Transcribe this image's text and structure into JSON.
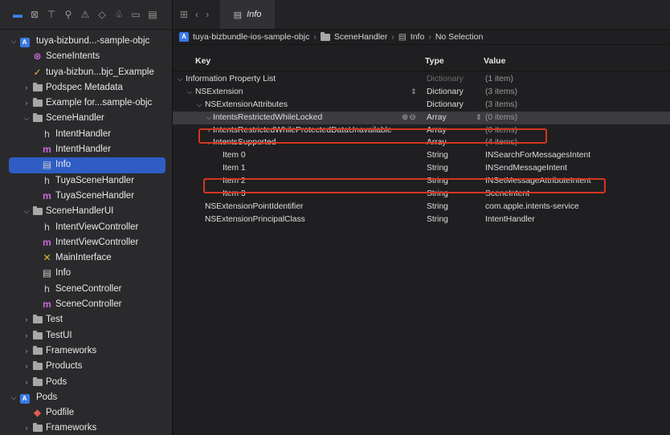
{
  "toolbar": {
    "icons": [
      "folder-icon",
      "source-control-icon",
      "hierarchy-icon",
      "search-icon",
      "warning-icon",
      "breakpoint-icon",
      "debug-icon",
      "tag-icon",
      "report-icon"
    ]
  },
  "sidebar": {
    "items": [
      {
        "label": "tuya-bizbund...-sample-objc",
        "icon": "project-icon",
        "level": 0,
        "disclosure": "open"
      },
      {
        "label": "SceneIntents",
        "icon": "intents-icon",
        "level": 1,
        "disclosure": "none"
      },
      {
        "label": "tuya-bizbun...bjc_Example",
        "icon": "entitlements-icon",
        "level": 1,
        "disclosure": "none"
      },
      {
        "label": "Podspec Metadata",
        "icon": "folder-icon",
        "level": 1,
        "disclosure": "closed"
      },
      {
        "label": "Example for...sample-objc",
        "icon": "folder-icon",
        "level": 1,
        "disclosure": "closed"
      },
      {
        "label": "SceneHandler",
        "icon": "folder-icon",
        "level": 1,
        "disclosure": "open"
      },
      {
        "label": "IntentHandler",
        "icon": "header-icon",
        "level": 2,
        "disclosure": "none"
      },
      {
        "label": "IntentHandler",
        "icon": "objc-icon",
        "level": 2,
        "disclosure": "none"
      },
      {
        "label": "Info",
        "icon": "table-icon",
        "level": 2,
        "disclosure": "none",
        "selected": true
      },
      {
        "label": "TuyaSceneHandler",
        "icon": "header-icon",
        "level": 2,
        "disclosure": "none"
      },
      {
        "label": "TuyaSceneHandler",
        "icon": "objc-icon",
        "level": 2,
        "disclosure": "none"
      },
      {
        "label": "SceneHandlerUI",
        "icon": "folder-icon",
        "level": 1,
        "disclosure": "open"
      },
      {
        "label": "IntentViewController",
        "icon": "header-icon",
        "level": 2,
        "disclosure": "none"
      },
      {
        "label": "IntentViewController",
        "icon": "objc-icon",
        "level": 2,
        "disclosure": "none"
      },
      {
        "label": "MainInterface",
        "icon": "storyboard-icon",
        "level": 2,
        "disclosure": "none"
      },
      {
        "label": "Info",
        "icon": "table-icon",
        "level": 2,
        "disclosure": "none"
      },
      {
        "label": "SceneController",
        "icon": "header-icon",
        "level": 2,
        "disclosure": "none"
      },
      {
        "label": "SceneController",
        "icon": "objc-icon",
        "level": 2,
        "disclosure": "none"
      },
      {
        "label": "Test",
        "icon": "folder-icon",
        "level": 1,
        "disclosure": "closed"
      },
      {
        "label": "TestUI",
        "icon": "folder-icon",
        "level": 1,
        "disclosure": "closed"
      },
      {
        "label": "Frameworks",
        "icon": "folder-icon",
        "level": 1,
        "disclosure": "closed"
      },
      {
        "label": "Products",
        "icon": "folder-icon",
        "level": 1,
        "disclosure": "closed"
      },
      {
        "label": "Pods",
        "icon": "folder-icon",
        "level": 1,
        "disclosure": "closed"
      },
      {
        "label": "Pods",
        "icon": "project-icon",
        "level": 0,
        "disclosure": "open"
      },
      {
        "label": "Podfile",
        "icon": "ruby-icon",
        "level": 1,
        "disclosure": "none"
      },
      {
        "label": "Frameworks",
        "icon": "folder-icon",
        "level": 1,
        "disclosure": "closed"
      }
    ]
  },
  "tab": {
    "label": "Info"
  },
  "jumpbar": {
    "items": [
      "tuya-bizbundle-ios-sample-objc",
      "SceneHandler",
      "Info",
      "No Selection"
    ]
  },
  "plist": {
    "columns": {
      "key": "Key",
      "type": "Type",
      "value": "Value"
    },
    "rows": [
      {
        "key": "Information Property List",
        "type": "Dictionary",
        "value": "(1 item)",
        "level": 0,
        "disclosure": "open",
        "type_dim": true
      },
      {
        "key": "NSExtension",
        "type": "Dictionary",
        "value": "(3 items)",
        "level": 1,
        "disclosure": "open",
        "stepper": true
      },
      {
        "key": "NSExtensionAttributes",
        "type": "Dictionary",
        "value": "(3 items)",
        "level": 2,
        "disclosure": "open"
      },
      {
        "key": "IntentsRestrictedWhileLocked",
        "type": "Array",
        "value": "(0 items)",
        "level": 3,
        "disclosure": "open",
        "highlight": true
      },
      {
        "key": "IntentsRestrictedWhileProtectedDataUnavailable",
        "type": "Array",
        "value": "(0 items)",
        "level": 3,
        "disclosure": "closed"
      },
      {
        "key": "IntentsSupported",
        "type": "Array",
        "value": "(4 items)",
        "level": 3,
        "disclosure": "open"
      },
      {
        "key": "Item 0",
        "type": "String",
        "value": "INSearchForMessagesIntent",
        "level": 4,
        "disclosure": "none"
      },
      {
        "key": "Item 1",
        "type": "String",
        "value": "INSendMessageIntent",
        "level": 4,
        "disclosure": "none"
      },
      {
        "key": "Item 2",
        "type": "String",
        "value": "INSetMessageAttributeIntent",
        "level": 4,
        "disclosure": "none"
      },
      {
        "key": "Item 3",
        "type": "String",
        "value": "SceneIntent",
        "level": 4,
        "disclosure": "none"
      },
      {
        "key": "NSExtensionPointIdentifier",
        "type": "String",
        "value": "com.apple.intents-service",
        "level": 2,
        "disclosure": "none"
      },
      {
        "key": "NSExtensionPrincipalClass",
        "type": "String",
        "value": "IntentHandler",
        "level": 2,
        "disclosure": "none"
      }
    ]
  },
  "annotations": {
    "color": "#d3361f"
  }
}
